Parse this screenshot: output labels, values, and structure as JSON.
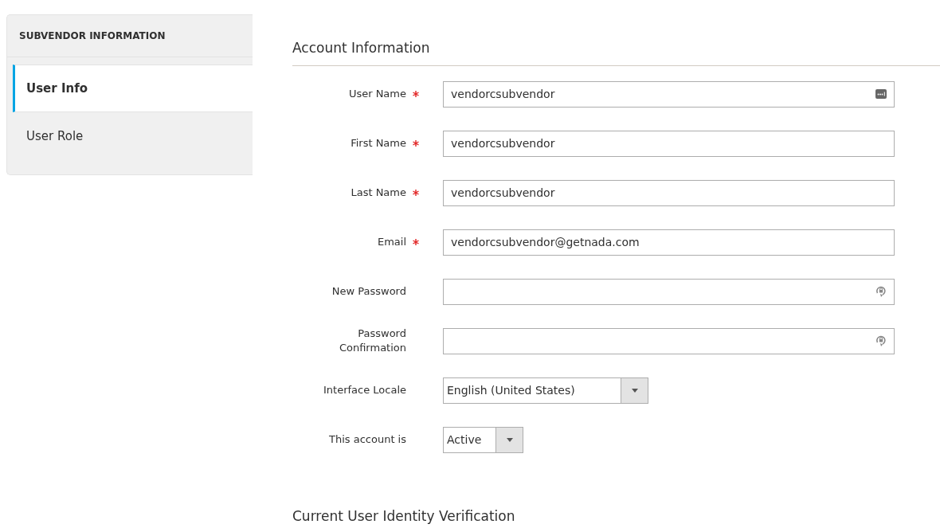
{
  "sidebar": {
    "title": "SUBVENDOR INFORMATION",
    "items": [
      {
        "label": "User Info",
        "selected": true
      },
      {
        "label": "User Role",
        "selected": false
      }
    ]
  },
  "section": {
    "title": "Account Information"
  },
  "fields": [
    {
      "kind": "autofill",
      "label": "User Name",
      "required": true,
      "value": "vendorcsubvendor"
    },
    {
      "kind": "text",
      "label": "First Name",
      "required": true,
      "value": "vendorcsubvendor"
    },
    {
      "kind": "text",
      "label": "Last Name",
      "required": true,
      "value": "vendorcsubvendor"
    },
    {
      "kind": "text",
      "label": "Email",
      "required": true,
      "value": "vendorcsubvendor@getnada.com"
    },
    {
      "kind": "password",
      "label": "New Password",
      "required": false
    },
    {
      "kind": "password",
      "label": "Password Confirmation",
      "required": false
    },
    {
      "kind": "select",
      "label": "Interface Locale",
      "required": false,
      "value": "English (United States)"
    },
    {
      "kind": "short-select",
      "label": "This account is",
      "required": false,
      "value": "Active"
    }
  ],
  "next_section": {
    "title": "Current User Identity Verification"
  }
}
